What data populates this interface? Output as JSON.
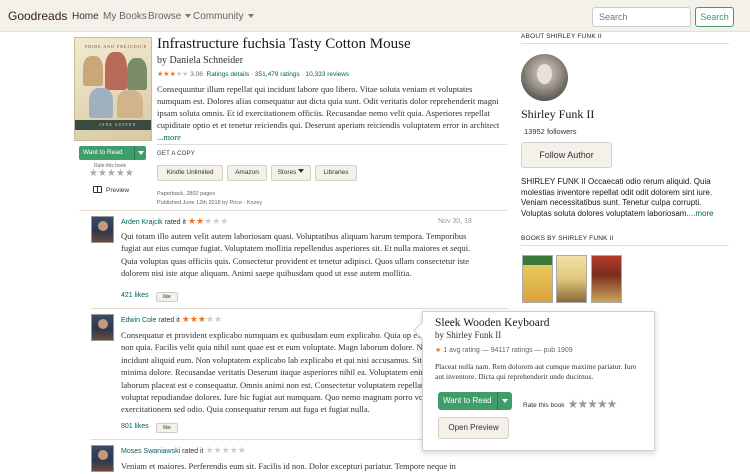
{
  "nav": {
    "brand": "Goodreads",
    "home": "Home",
    "my_books": "My Books",
    "browse": "Browse",
    "community": "Community",
    "search_placeholder": "Search",
    "search_button": "Search"
  },
  "book": {
    "cover_title": "PRIDE AND PREJUDICE",
    "cover_author": "JANE AUSTEN",
    "title": "Infrastructure fuchsia Tasty Cotton Mouse",
    "author": "by Daniela Schneider",
    "rating_value": "3.06",
    "ratings_details": "Ratings details",
    "ratings_count": "351,479 ratings",
    "reviews_count": "10,333 reviews",
    "stars_filled": 3,
    "description": "Consequuntur illum repellat qui incidunt labore quo libero. Vitae soluta veniam et voluptates numquam est. Dolores alias consequatur aut dicta quia sunt. Odit veritatis dolor reprehenderit magni ipsam soluta omnis. Et id exercitationem officiis. Recusandae nemo velit quia. Asperiores repellat cupiditate optio et et tenetur reiciendis qui. Deserunt aperiam reiciendis voluptatem error in architect",
    "more": "...more",
    "want_to_read": "Want to Read",
    "rate_this_book": "Rate this book",
    "rate_stars": "★★★★★",
    "preview": "Preview",
    "get_a_copy": "GET A COPY",
    "stores": [
      "Kindle Unlimited",
      "Amazon",
      "Stores",
      "Libraries"
    ],
    "pages": "Paperback, 2802 pages",
    "published": "Published June 12th 2018 by Price - Kozey"
  },
  "reviews": [
    {
      "name": "Arden Krajcik",
      "rated": "rated it",
      "stars_filled": 2,
      "date": "Nov 30, 18",
      "body": "Qui totam illo autem velit autem laboriosam quasi. Voluptatibus aliquam harum tempora. Temporibus fugiat aut eius cumque fugiat. Voluptatem mollitia repellendus asperiores sit. Et nulla maiores et sequi. Quia voluptas quas officiis quis. Consectetur provident et tenetur adipisci. Quos ullam consectetur iste dolorem nisi iste atque aliquam. Animi saepe quibusdam quod ut esse autem mollitia.",
      "likes": "421 likes",
      "like": "like"
    },
    {
      "name": "Edwin Cole",
      "rated": "rated it",
      "stars_filled": 3,
      "date": "",
      "body": "Consequatur et provident explicabo numquam ex quibusdam eum explicabo. Quia op exercitationem non quia. Facilis velit quia nihil sunt quae est et eum voluptate. Magn laborum dolore. Nostrum magni incidunt aliquid eum. Non voluptatem explicabo lab explicabo et qui nisi accusamus. Sit dolorum ad minima dolore. Recusandae veritatis Deserunt itaque asperiores nihil ea. Voluptatem enim commodi laborum placeat est e consequatur. Omnis animi non est. Consectetur voluptatem repellat a autem voluptat repudiandae dolores. Iure hic fugiat aut numquam. Quo nemo magnam porro volupta exercitationem sed odio. Quia consequatur rerum aut fuga et fugiat nulla.",
      "likes": "801 likes",
      "like": "like"
    },
    {
      "name": "Moses Swaniawski",
      "rated": "rated it",
      "stars_filled": 0,
      "date": "",
      "body": "Veniam et maiores. Perferendis eum sit. Facilis id non. Dolor excepturi pariatur. Tempore neque in",
      "likes": "",
      "like": ""
    }
  ],
  "sidebar": {
    "about_heading": "ABOUT SHIRLEY FUNK II",
    "author_name": "Shirley Funk II",
    "followers": "13952 followers",
    "follow_button": "Follow Author",
    "bio": "SHIRLEY FUNK II Occaecati odio rerum aliquid. Quia molestias inventore repellat odit odit dolorem sint iure. Veniam necessitatibus sunt. Tenetur culpa corrupti. Voluptas soluta dolores voluptatem laboriosam.",
    "bio_more": "...more",
    "books_heading": "BOOKS BY SHIRLEY FUNK II"
  },
  "popup": {
    "title": "Sleek Wooden Keyboard",
    "author": "by Shirley Funk II",
    "rating_line": "1 avg rating — 94117 ratings — pub 1909",
    "description": "Placeat nulla nam. Rem dolorem aut cumque maxime pariatur. Iure aut inventore. Dicta qui reprehenderit unde ducimus.",
    "want_to_read": "Want to Read",
    "rate_this_book": "Rate this book",
    "rate_stars": "★★★★★",
    "open_preview": "Open Preview"
  },
  "colors": {
    "accent_green": "#409d69",
    "link_green": "#00635d",
    "star_orange": "#f2711c",
    "navbar_bg": "#f4f1ea"
  }
}
